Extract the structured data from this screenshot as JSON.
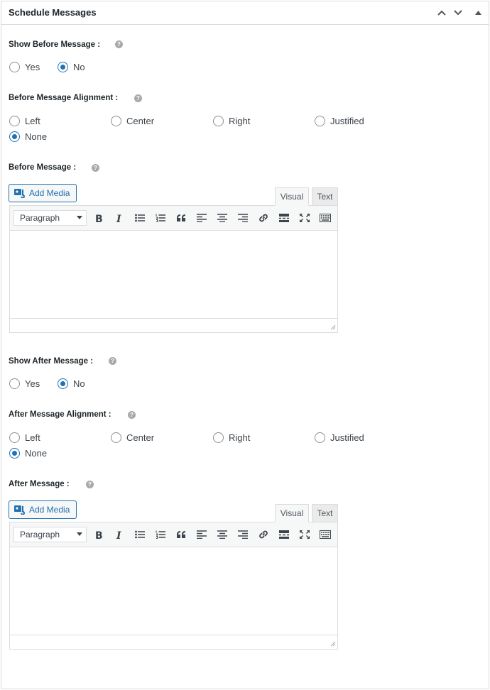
{
  "panel": {
    "title": "Schedule Messages",
    "controls": [
      "chevron-up-icon",
      "chevron-down-icon",
      "triangle-up-icon"
    ]
  },
  "before": {
    "show_label": "Show Before Message :",
    "show_options": [
      {
        "label": "Yes",
        "checked": false
      },
      {
        "label": "No",
        "checked": true
      }
    ],
    "align_label": "Before Message Alignment :",
    "align_options": [
      {
        "label": "Left",
        "checked": false
      },
      {
        "label": "Center",
        "checked": false
      },
      {
        "label": "Right",
        "checked": false
      },
      {
        "label": "Justified",
        "checked": false
      },
      {
        "label": "None",
        "checked": true
      }
    ],
    "message_label": "Before Message :",
    "add_media": "Add Media",
    "tab_visual": "Visual",
    "tab_text": "Text",
    "format": "Paragraph"
  },
  "after": {
    "show_label": "Show After Message :",
    "show_options": [
      {
        "label": "Yes",
        "checked": false
      },
      {
        "label": "No",
        "checked": true
      }
    ],
    "align_label": "After Message Alignment :",
    "align_options": [
      {
        "label": "Left",
        "checked": false
      },
      {
        "label": "Center",
        "checked": false
      },
      {
        "label": "Right",
        "checked": false
      },
      {
        "label": "Justified",
        "checked": false
      },
      {
        "label": "None",
        "checked": true
      }
    ],
    "message_label": "After Message :",
    "add_media": "Add Media",
    "tab_visual": "Visual",
    "tab_text": "Text",
    "format": "Paragraph"
  },
  "help_glyph": "?",
  "toolbar_icons": [
    "bold-icon",
    "italic-icon",
    "bulleted-list-icon",
    "numbered-list-icon",
    "blockquote-icon",
    "align-left-icon",
    "align-center-icon",
    "align-right-icon",
    "link-icon",
    "read-more-icon",
    "fullscreen-icon",
    "toolbar-toggle-icon"
  ],
  "colors": {
    "accent": "#2271b1",
    "border": "#dcdcde"
  }
}
